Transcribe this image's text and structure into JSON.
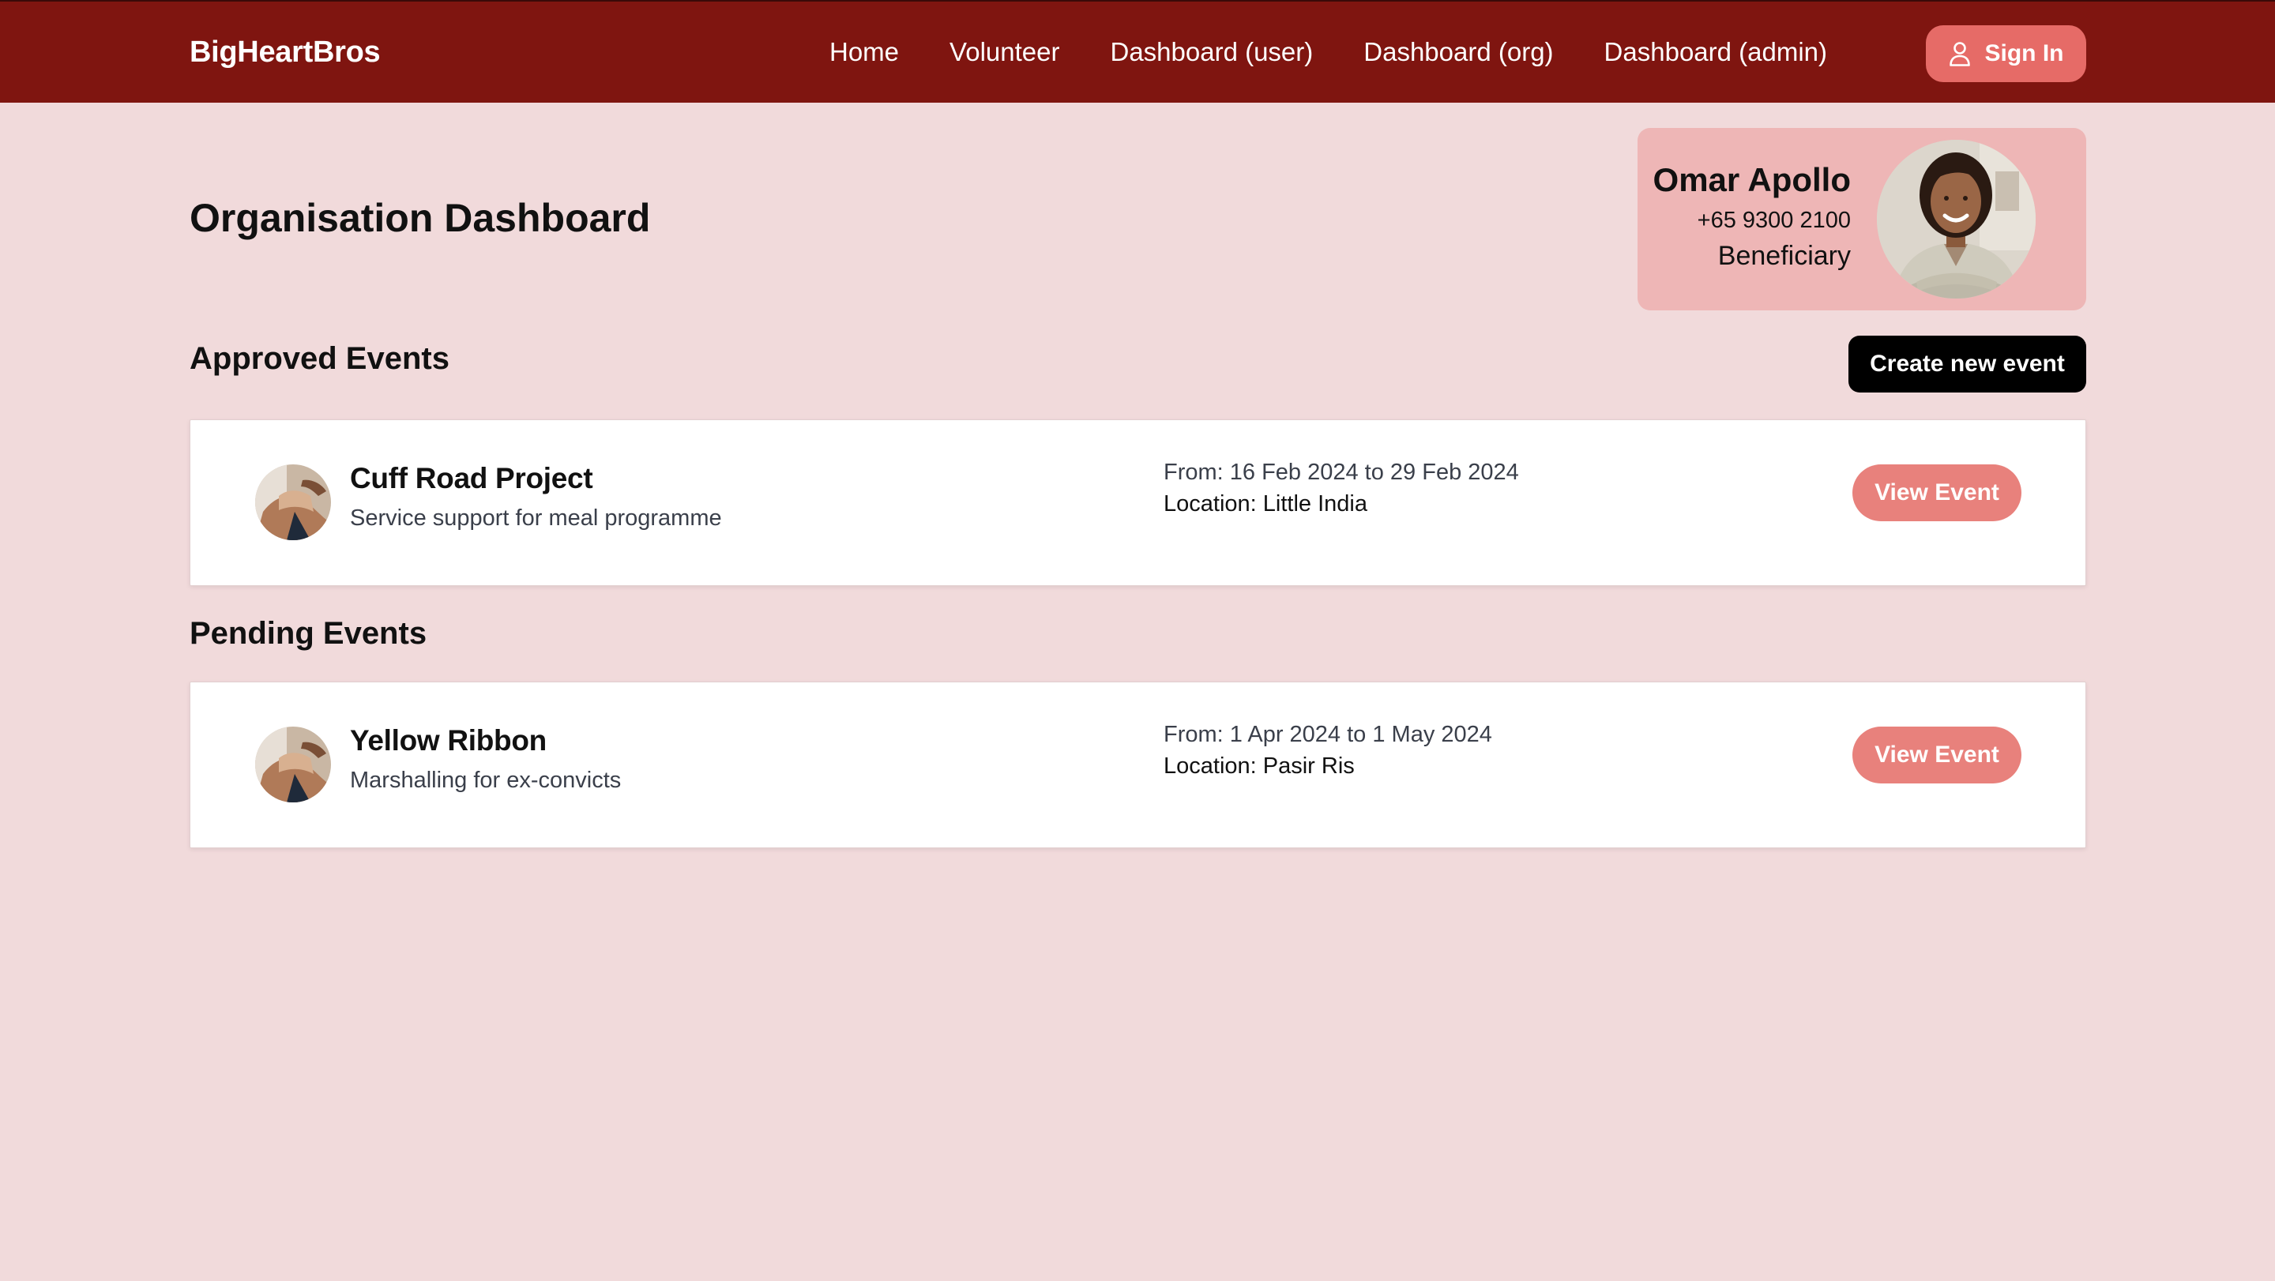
{
  "navbar": {
    "brand": "BigHeartBros",
    "links": [
      "Home",
      "Volunteer",
      "Dashboard (user)",
      "Dashboard (org)",
      "Dashboard (admin)"
    ],
    "sign_in_label": "Sign In",
    "sign_in_icon": "user-icon",
    "background_color": "#7f1510",
    "sign_in_color": "#e66b67"
  },
  "page": {
    "title": "Organisation Dashboard",
    "background_color": "#f1dadb"
  },
  "profile": {
    "name": "Omar Apollo",
    "phone": "+65 9300 2100",
    "role": "Beneficiary",
    "card_color": "#eeb6b6"
  },
  "approved": {
    "title": "Approved Events",
    "create_label": "Create new event",
    "events": [
      {
        "name": "Cuff Road Project",
        "description": "Service support for meal programme",
        "dates": "From: 16 Feb 2024 to 29 Feb 2024",
        "location": "Location: Little India",
        "action_label": "View Event"
      }
    ]
  },
  "pending": {
    "title": "Pending Events",
    "events": [
      {
        "name": "Yellow Ribbon",
        "description": "Marshalling for ex-convicts",
        "dates": "From: 1 Apr 2024 to 1 May 2024",
        "location": "Location: Pasir Ris",
        "action_label": "View Event"
      }
    ]
  },
  "colors": {
    "view_button": "#e8817c",
    "create_button": "#000000"
  }
}
